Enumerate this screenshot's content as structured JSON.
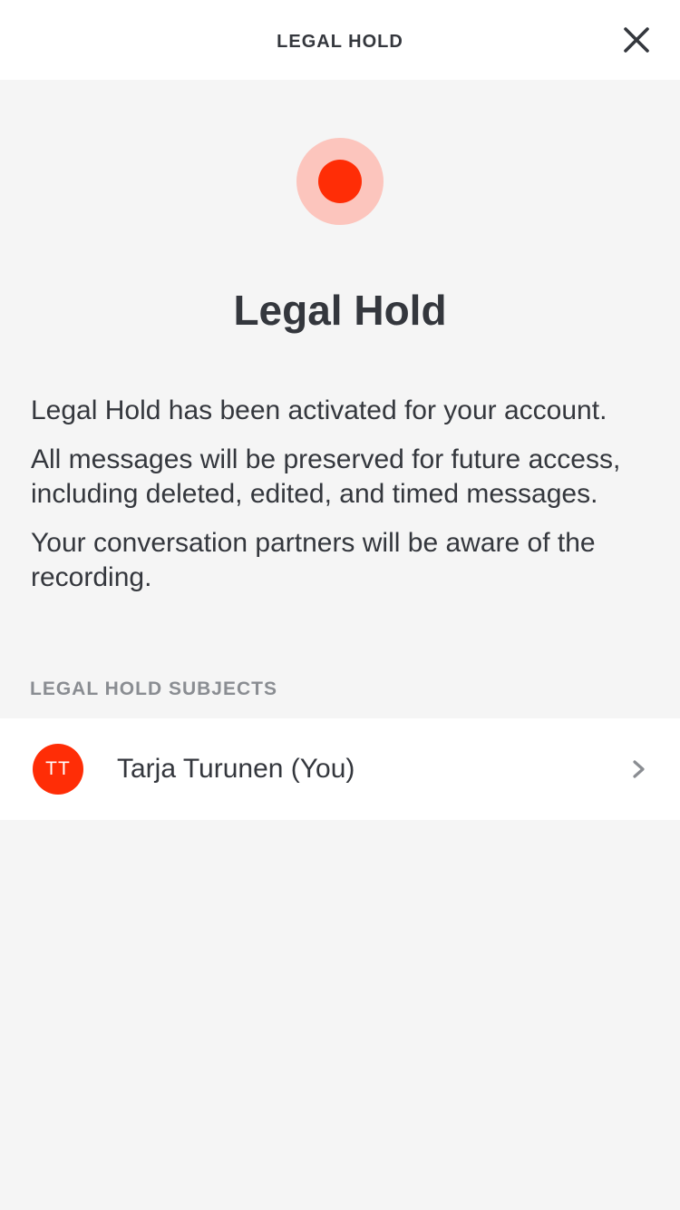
{
  "header": {
    "title": "LEGAL HOLD",
    "close_icon": "close-icon"
  },
  "indicator": {
    "icon": "recording-dot-icon",
    "outer_color": "#fcc5bd",
    "inner_color": "#ff2d06"
  },
  "main": {
    "title": "Legal Hold",
    "paragraphs": [
      "Legal Hold has been activated for your account.",
      "All messages will be preserved for future access, including deleted, edited, and timed messages.",
      "Your conversation partners will be aware of the recording."
    ]
  },
  "subjects": {
    "section_label": "LEGAL HOLD SUBJECTS",
    "items": [
      {
        "initials": "TT",
        "name": "Tarja Turunen (You)",
        "avatar_color": "#ff2d06",
        "chevron_icon": "chevron-right-icon"
      }
    ]
  }
}
